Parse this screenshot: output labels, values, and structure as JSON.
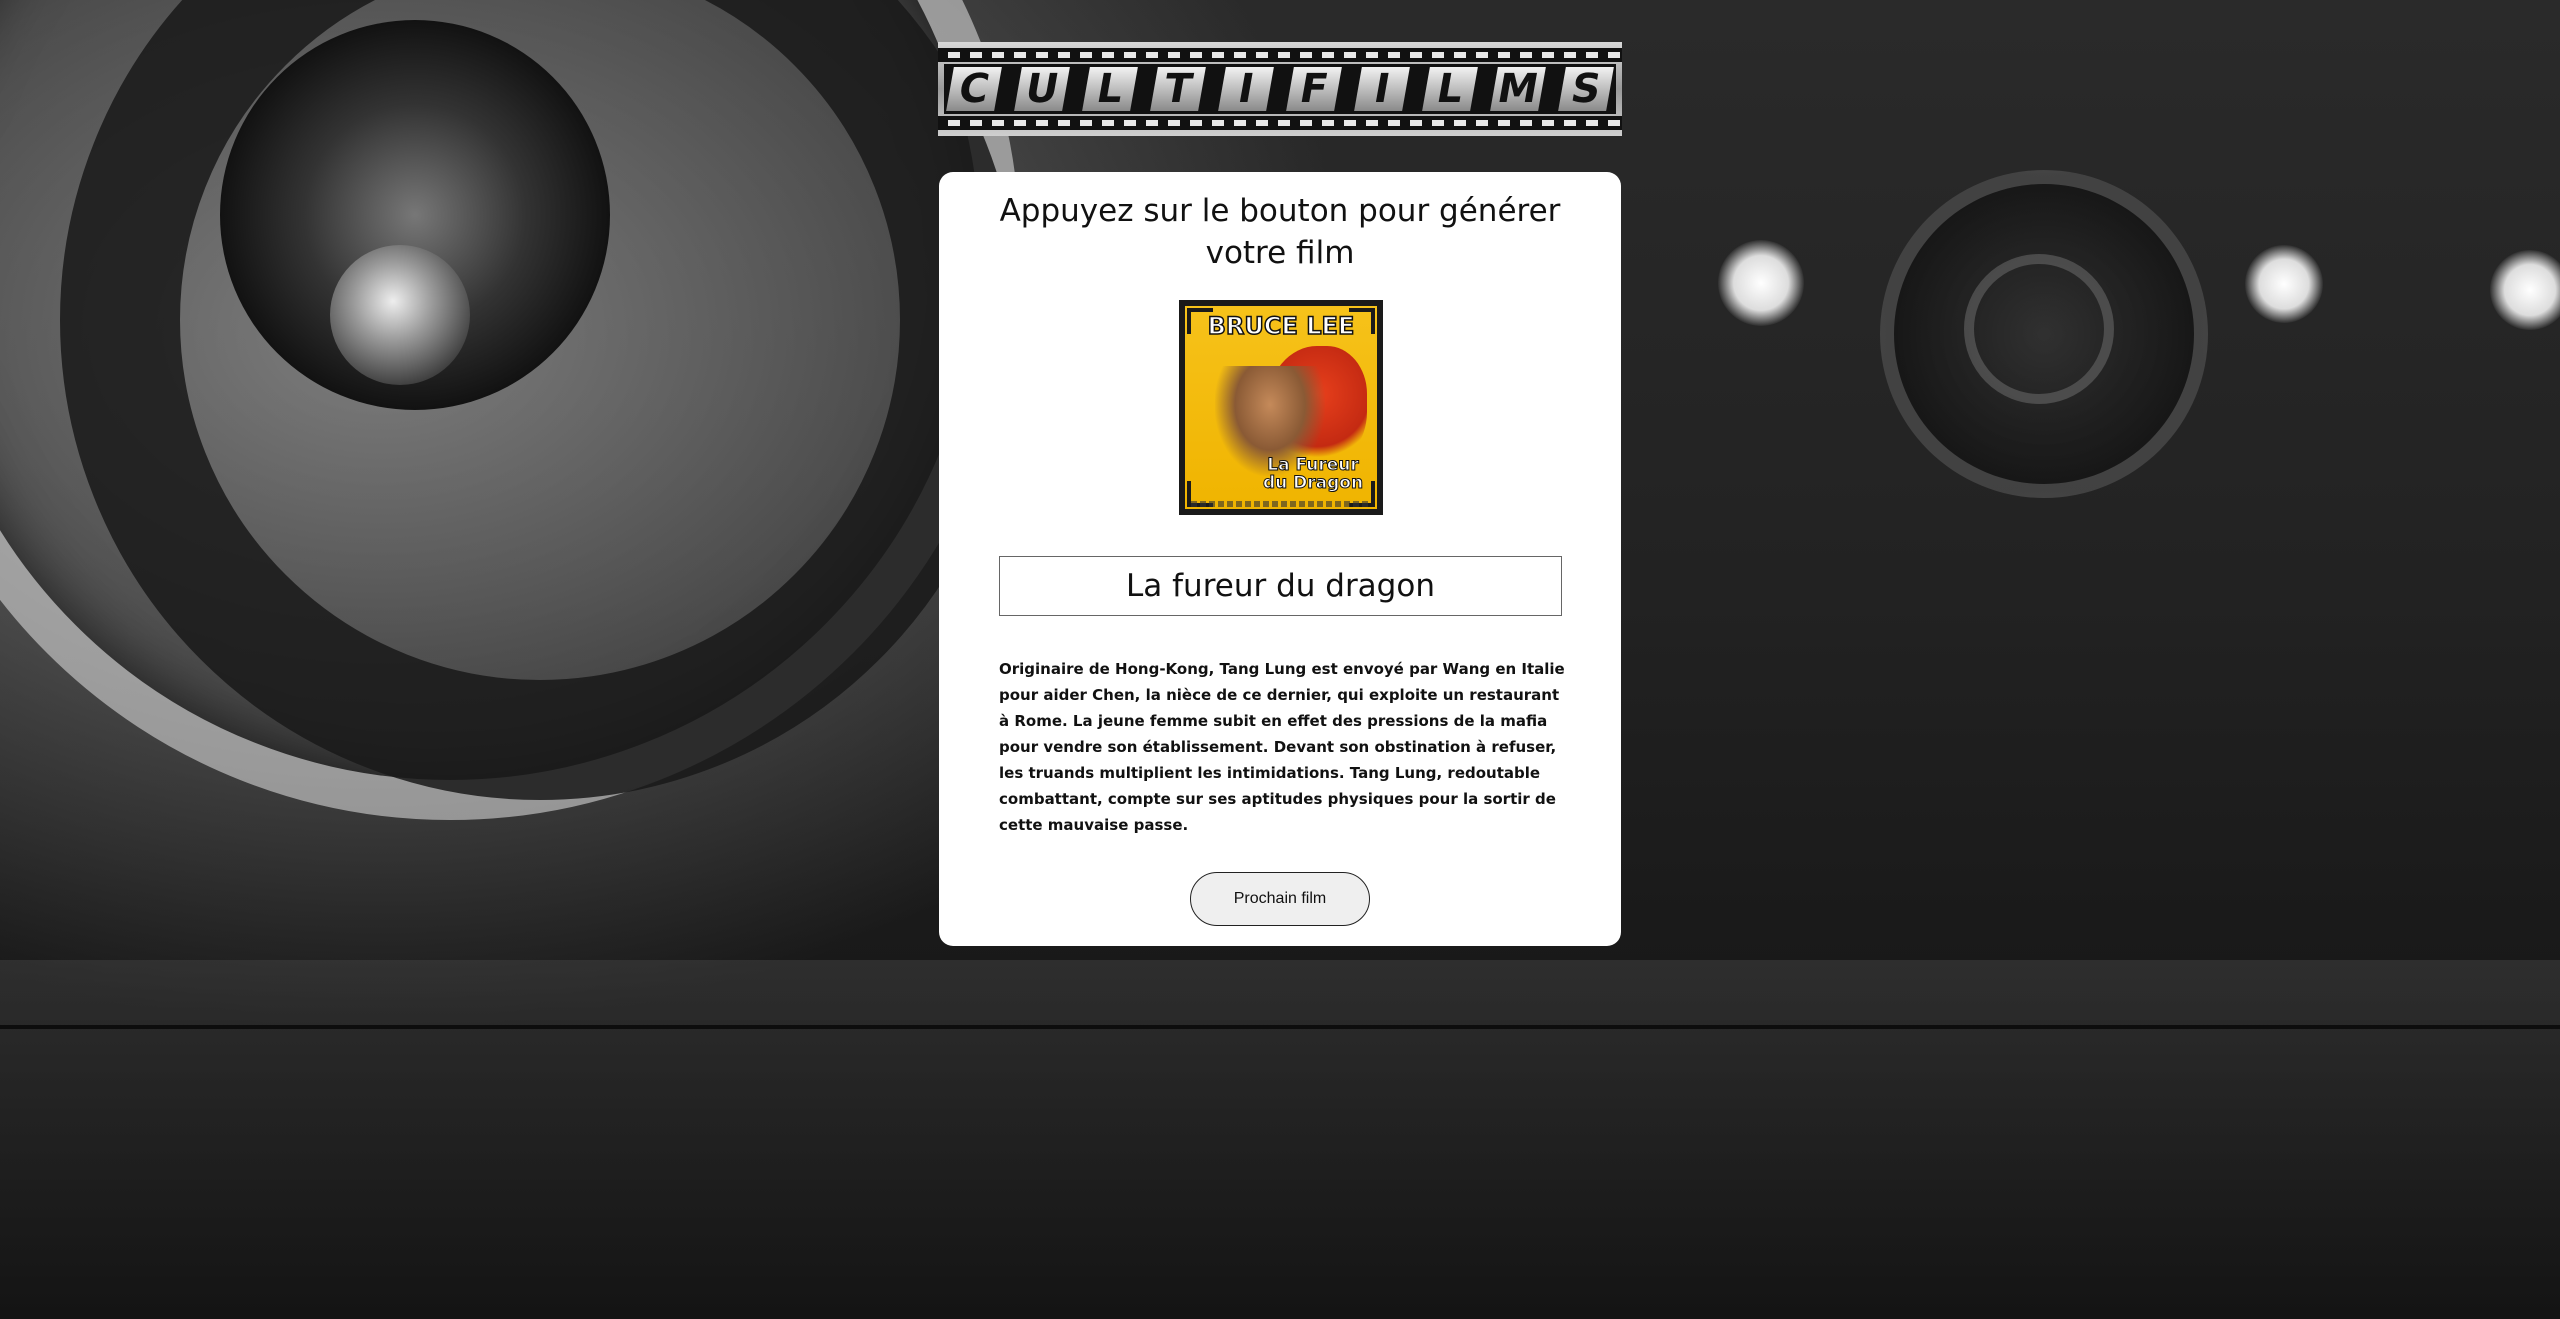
{
  "logo": {
    "letters": [
      "C",
      "U",
      "L",
      "T",
      "I",
      "F",
      "I",
      "L",
      "M",
      "S"
    ]
  },
  "main": {
    "heading": "Appuyez sur le bouton pour générer votre film",
    "poster": {
      "actor": "BRUCE LEE",
      "title": "La Fureur du Dragon"
    },
    "movie_title": "La fureur du dragon",
    "synopsis": "Originaire de Hong-Kong, Tang Lung est envoyé par Wang en Italie pour aider Chen, la nièce de ce dernier, qui exploite un restaurant à Rome. La jeune femme subit en effet des pressions de la mafia pour vendre son établissement. Devant son obstination à refuser, les truands multiplient les intimidations. Tang Lung, redoutable combattant, compte sur ses aptitudes physiques pour la sortir de cette mauvaise passe.",
    "next_button": "Prochain film"
  },
  "colors": {
    "card_bg": "#ffffff",
    "poster_yellow": "#f6c21a",
    "poster_red": "#c42a12",
    "button_bg": "#efefef"
  }
}
